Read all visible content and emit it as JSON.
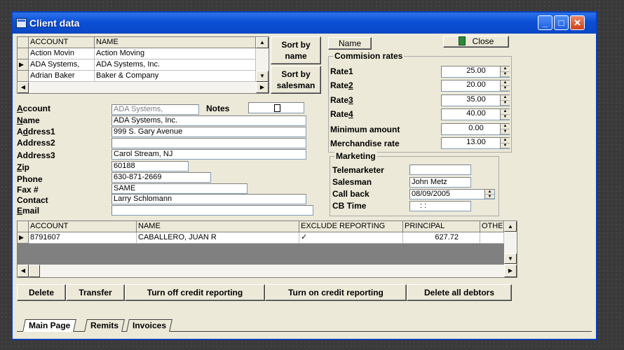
{
  "window": {
    "title": "Client data",
    "minimize": "_",
    "maximize": "□",
    "close": "✕"
  },
  "top_grid": {
    "columns": [
      "ACCOUNT",
      "NAME"
    ],
    "rows": [
      {
        "marker": "",
        "account": "Action Movin",
        "name": "Action Moving"
      },
      {
        "marker": "▶",
        "account": "ADA Systems,",
        "name": "ADA Systems, Inc."
      },
      {
        "marker": "",
        "account": "Adrian Baker",
        "name": "Baker & Company"
      }
    ]
  },
  "sort_buttons": {
    "by_name": "Sort by name",
    "by_salesman": "Sort by salesman"
  },
  "name_button": "Name",
  "close_button": "Close",
  "form": {
    "account": {
      "label": "Account",
      "value": "ADA Systems,"
    },
    "notes": {
      "label": "Notes"
    },
    "name": {
      "label": "Name",
      "value": "ADA Systems, Inc."
    },
    "address1": {
      "label": "Address1",
      "value": "999 S. Gary Avenue"
    },
    "address2": {
      "label": "Address2",
      "value": ""
    },
    "address3": {
      "label": "Address3",
      "value": "Carol Stream, NJ"
    },
    "zip": {
      "label": "Zip",
      "value": "60188"
    },
    "phone": {
      "label": "Phone",
      "value": "630-871-2669"
    },
    "fax": {
      "label": "Fax #",
      "value": "SAME"
    },
    "contact": {
      "label": "Contact",
      "value": "Larry Schlomann"
    },
    "email": {
      "label": "Email",
      "value": ""
    }
  },
  "commission": {
    "title": "Commision rates",
    "rate1": {
      "label": "Rate1",
      "value": "25.00"
    },
    "rate2": {
      "label": "Rate2",
      "value": "20.00"
    },
    "rate3": {
      "label": "Rate3",
      "value": "35.00"
    },
    "rate4": {
      "label": "Rate4",
      "value": "40.00"
    },
    "minimum": {
      "label": "Minimum amount",
      "value": "0.00"
    },
    "merchandise": {
      "label": "Merchandise rate",
      "value": "13.00"
    }
  },
  "marketing": {
    "title": "Marketing",
    "telemarketer": {
      "label": "Telemarketer",
      "value": ""
    },
    "salesman": {
      "label": "Salesman",
      "value": "John Metz"
    },
    "callback": {
      "label": "Call back",
      "value": "08/09/2005"
    },
    "cbtime": {
      "label": "CB Time",
      "value": ":   :"
    }
  },
  "debtor_grid": {
    "columns": [
      "ACCOUNT",
      "NAME",
      "EXCLUDE REPORTING",
      "PRINCIPAL",
      "OTHE"
    ],
    "row": {
      "marker": "▶",
      "account": "8791607",
      "name": "CABALLERO, JUAN R",
      "exclude": "✓",
      "principal": "627.72",
      "other": ""
    }
  },
  "actions": {
    "delete": "Delete",
    "transfer": "Transfer",
    "off": "Turn off credit reporting",
    "on": "Turn on credit reporting",
    "delete_all": "Delete all debtors"
  },
  "tabs": [
    "Main Page",
    "Remits",
    "Invoices"
  ]
}
